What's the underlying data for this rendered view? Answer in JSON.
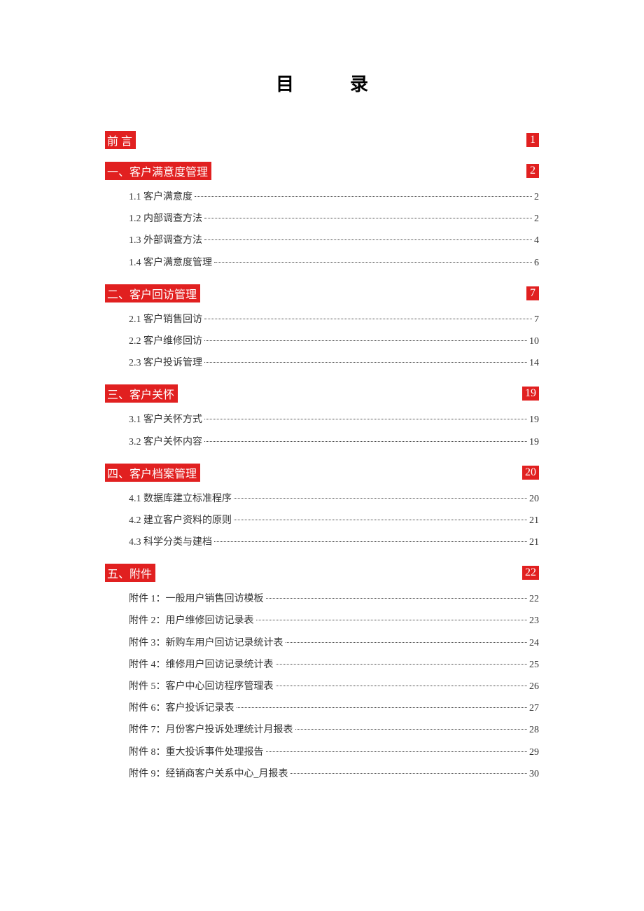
{
  "title": "目录",
  "sections": [
    {
      "title": "前          言",
      "page": "1",
      "spaced": true,
      "entries": []
    },
    {
      "title": "一、客户满意度管理",
      "page": "2",
      "entries": [
        {
          "label": "1.1 客户满意度",
          "page": "2"
        },
        {
          "label": "1.2 内部调查方法",
          "page": "2"
        },
        {
          "label": "1.3 外部调查方法",
          "page": "4"
        },
        {
          "label": "1.4 客户满意度管理",
          "page": "6"
        }
      ]
    },
    {
      "title": "二、客户回访管理",
      "page": "7",
      "entries": [
        {
          "label": "2.1 客户销售回访",
          "page": "7"
        },
        {
          "label": "2.2 客户维修回访",
          "page": "10"
        },
        {
          "label": "2.3 客户投诉管理",
          "page": "14"
        }
      ]
    },
    {
      "title": "三、客户关怀",
      "page": "19",
      "entries": [
        {
          "label": "3.1 客户关怀方式",
          "page": "19"
        },
        {
          "label": "3.2 客户关怀内容",
          "page": "19"
        }
      ]
    },
    {
      "title": "四、客户档案管理",
      "page": "20",
      "entries": [
        {
          "label": "4.1 数据库建立标准程序",
          "page": "20"
        },
        {
          "label": "4.2 建立客户资料的原则",
          "page": "21"
        },
        {
          "label": "4.3 科学分类与建档",
          "page": "21"
        }
      ]
    },
    {
      "title": "五、附件",
      "page": "22",
      "entries": [
        {
          "label": "附件 1：一般用户销售回访模板",
          "page": "22"
        },
        {
          "label": "附件 2：用户维修回访记录表",
          "page": "23"
        },
        {
          "label": "附件 3：新购车用户回访记录统计表",
          "page": "24"
        },
        {
          "label": "附件 4：维修用户回访记录统计表",
          "page": "25"
        },
        {
          "label": "附件 5：客户中心回访程序管理表",
          "page": "26"
        },
        {
          "label": "附件 6：客户投诉记录表",
          "page": "27"
        },
        {
          "label": "附件 7：月份客户投诉处理统计月报表",
          "page": "28"
        },
        {
          "label": "附件 8：重大投诉事件处理报告",
          "page": "29"
        },
        {
          "label": "附件 9：经销商客户关系中心_月报表",
          "page": "30"
        }
      ]
    }
  ]
}
